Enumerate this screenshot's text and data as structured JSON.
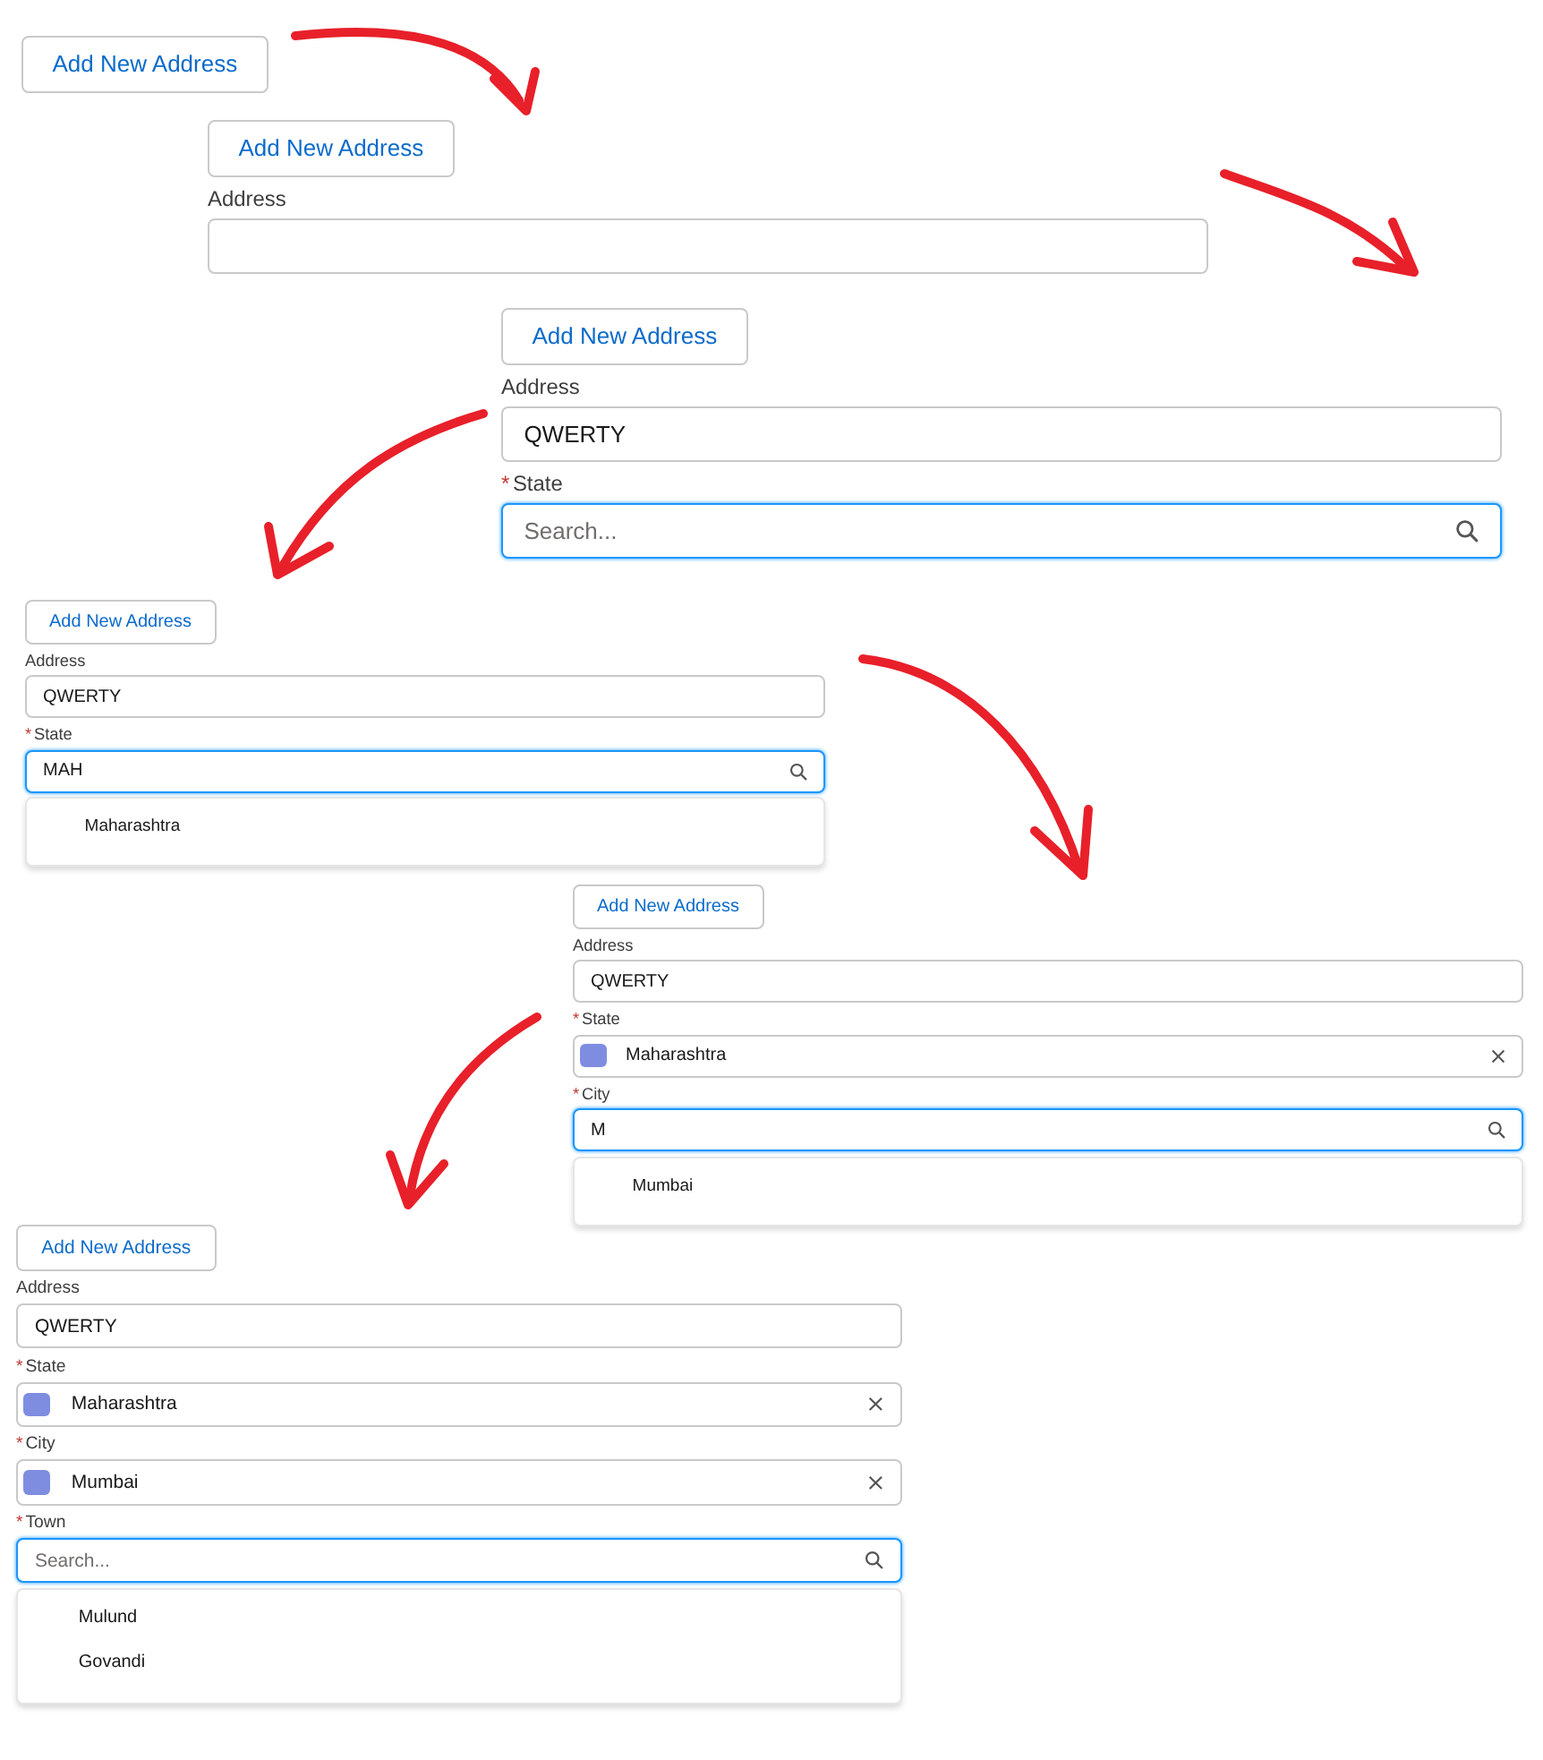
{
  "steps": [
    {
      "button": "Add New Address"
    },
    {
      "button": "Add New Address",
      "fields": [
        {
          "kind": "text",
          "label": "Address",
          "focused": false
        }
      ]
    },
    {
      "button": "Add New Address",
      "fields": [
        {
          "kind": "text",
          "label": "Address",
          "value": "QWERTY",
          "focused": false
        },
        {
          "kind": "search",
          "label": "State",
          "required": "*",
          "placeholder": "Search...",
          "focused": true
        }
      ]
    },
    {
      "button": "Add New Address",
      "fields": [
        {
          "kind": "text",
          "label": "Address",
          "value": "QWERTY",
          "focused": false
        },
        {
          "kind": "search",
          "label": "State",
          "required": "*",
          "value": "MAH",
          "focused": true,
          "options": [
            "Maharashtra"
          ]
        }
      ]
    },
    {
      "button": "Add New Address",
      "fields": [
        {
          "kind": "text",
          "label": "Address",
          "value": "QWERTY",
          "focused": false
        },
        {
          "kind": "lookup",
          "label": "State",
          "required": "*",
          "value": "Maharashtra",
          "focused": false
        },
        {
          "kind": "search",
          "label": "City",
          "required": "*",
          "value": "M",
          "focused": true,
          "options": [
            "Mumbai"
          ]
        }
      ]
    },
    {
      "button": "Add New Address",
      "fields": [
        {
          "kind": "text",
          "label": "Address",
          "value": "QWERTY",
          "focused": false
        },
        {
          "kind": "lookup",
          "label": "State",
          "required": "*",
          "value": "Maharashtra",
          "focused": false
        },
        {
          "kind": "lookup",
          "label": "City",
          "required": "*",
          "value": "Mumbai",
          "focused": false
        },
        {
          "kind": "search",
          "label": "Town",
          "required": "*",
          "placeholder": "Search...",
          "focused": true,
          "options": [
            "Mulund",
            "Govandi"
          ]
        }
      ]
    }
  ]
}
